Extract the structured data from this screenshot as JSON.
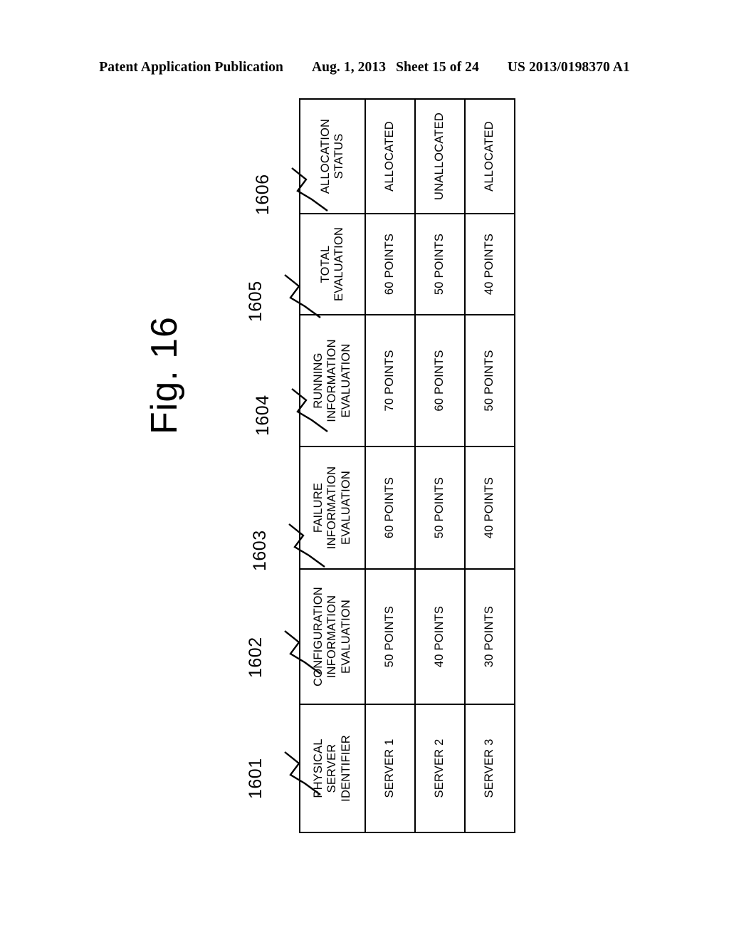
{
  "header": {
    "publication": "Patent Application Publication",
    "date": "Aug. 1, 2013",
    "sheet": "Sheet 15 of 24",
    "patent_number": "US 2013/0198370 A1"
  },
  "figure": {
    "label": "Fig. 16"
  },
  "reference_numerals": {
    "n1601": "1601",
    "n1602": "1602",
    "n1603": "1603",
    "n1604": "1604",
    "n1605": "1605",
    "n1606": "1606"
  },
  "table": {
    "columns": [
      {
        "ref": "1601",
        "header": "PHYSICAL\nSERVER\nIDENTIFIER"
      },
      {
        "ref": "1602",
        "header": "CONFIGURATION\nINFORMATION\nEVALUATION"
      },
      {
        "ref": "1603",
        "header": "FAILURE\nINFORMATION\nEVALUATION"
      },
      {
        "ref": "1604",
        "header": "RUNNING\nINFORMATION\nEVALUATION"
      },
      {
        "ref": "1605",
        "header": "TOTAL\nEVALUATION"
      },
      {
        "ref": "1606",
        "header": "ALLOCATION\nSTATUS"
      }
    ],
    "rows": [
      {
        "identifier": "SERVER 1",
        "configuration_information_evaluation": "50 POINTS",
        "failure_information_evaluation": "60 POINTS",
        "running_information_evaluation": "70 POINTS",
        "total_evaluation": "60 POINTS",
        "allocation_status": "ALLOCATED"
      },
      {
        "identifier": "SERVER 2",
        "configuration_information_evaluation": "40 POINTS",
        "failure_information_evaluation": "50 POINTS",
        "running_information_evaluation": "60 POINTS",
        "total_evaluation": "50 POINTS",
        "allocation_status": "UNALLOCATED"
      },
      {
        "identifier": "SERVER 3",
        "configuration_information_evaluation": "30 POINTS",
        "failure_information_evaluation": "40 POINTS",
        "running_information_evaluation": "50 POINTS",
        "total_evaluation": "40 POINTS",
        "allocation_status": "ALLOCATED"
      }
    ]
  }
}
